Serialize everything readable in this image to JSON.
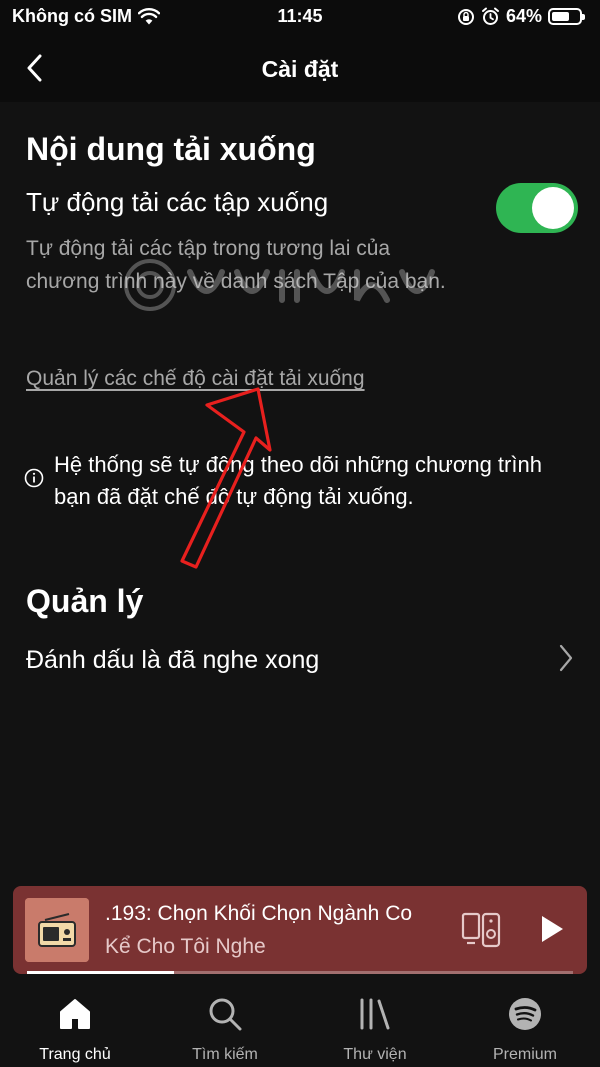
{
  "status_bar": {
    "carrier": "Không có SIM",
    "time": "11:45",
    "battery": "64%",
    "battery_level": 0.64
  },
  "header": {
    "title": "Cài đặt"
  },
  "downloads": {
    "section_title": "Nội dung tải xuống",
    "auto_download_label": "Tự động tải các tập xuống",
    "auto_download_enabled": true,
    "description": "Tự động tải các tập trong tương lai của chương trình này về danh sách Tập của bạn.",
    "manage_link": "Quản lý các chế độ cài đặt tải xuống",
    "info_text": "Hệ thống sẽ tự động theo dõi những chương trình bạn đã đặt chế độ tự động tải xuống."
  },
  "manage": {
    "section_title": "Quản lý",
    "mark_played_label": "Đánh dấu là đã nghe xong"
  },
  "player": {
    "track_title": ".193: Chọn Khối Chọn Ngành Co",
    "artist": "Kể Cho Tôi Nghe",
    "progress": 0.27
  },
  "bottom_nav": {
    "tabs": [
      {
        "label": "Trang chủ",
        "icon": "home-icon",
        "active": true
      },
      {
        "label": "Tìm kiếm",
        "icon": "search-icon",
        "active": false
      },
      {
        "label": "Thư viện",
        "icon": "library-icon",
        "active": false
      },
      {
        "label": "Premium",
        "icon": "spotify-icon",
        "active": false
      }
    ]
  },
  "colors": {
    "background": "#121212",
    "toggle_on": "#2fb553",
    "player_bg": "#7a3232",
    "annotation_arrow": "#e8201e"
  }
}
